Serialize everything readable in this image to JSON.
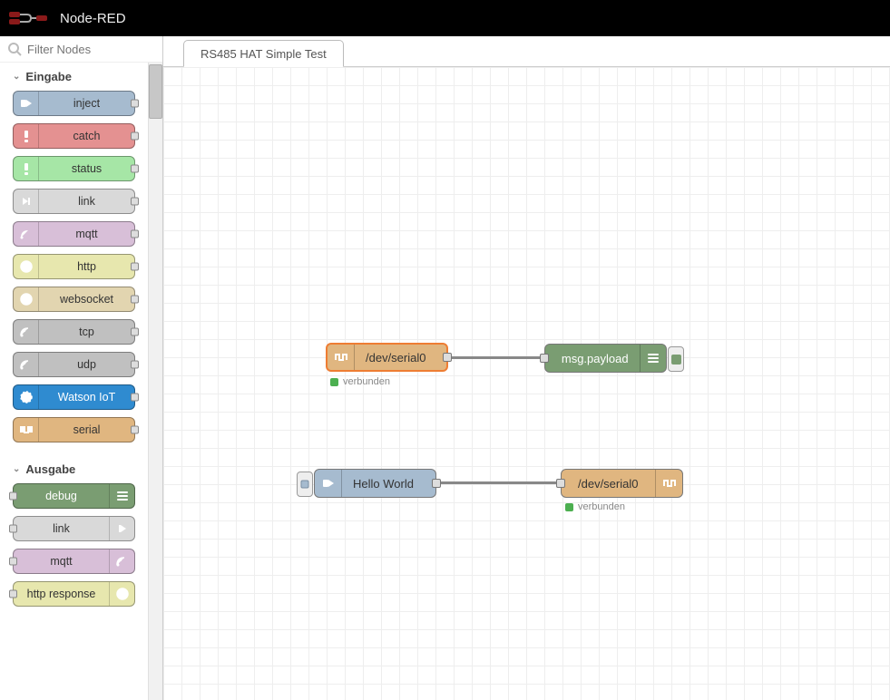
{
  "header": {
    "title": "Node-RED"
  },
  "palette": {
    "search_placeholder": "Filter Nodes",
    "categories": {
      "input": {
        "label": "Eingabe"
      },
      "output": {
        "label": "Ausgabe"
      }
    },
    "input_nodes": {
      "inject": {
        "label": "inject"
      },
      "catch": {
        "label": "catch"
      },
      "status": {
        "label": "status"
      },
      "link": {
        "label": "link"
      },
      "mqtt": {
        "label": "mqtt"
      },
      "http": {
        "label": "http"
      },
      "websocket": {
        "label": "websocket"
      },
      "tcp": {
        "label": "tcp"
      },
      "udp": {
        "label": "udp"
      },
      "watson": {
        "label": "Watson IoT"
      },
      "serial": {
        "label": "serial"
      }
    },
    "output_nodes": {
      "debug": {
        "label": "debug"
      },
      "link": {
        "label": "link"
      },
      "mqtt": {
        "label": "mqtt"
      },
      "httpresponse": {
        "label": "http response"
      }
    }
  },
  "tabs": {
    "active": "RS485 HAT Simple Test"
  },
  "flow": {
    "serial_in": {
      "label": "/dev/serial0",
      "status": "verbunden"
    },
    "debug": {
      "label": "msg.payload"
    },
    "inject": {
      "label": "Hello World"
    },
    "serial_out": {
      "label": "/dev/serial0",
      "status": "verbunden"
    }
  }
}
